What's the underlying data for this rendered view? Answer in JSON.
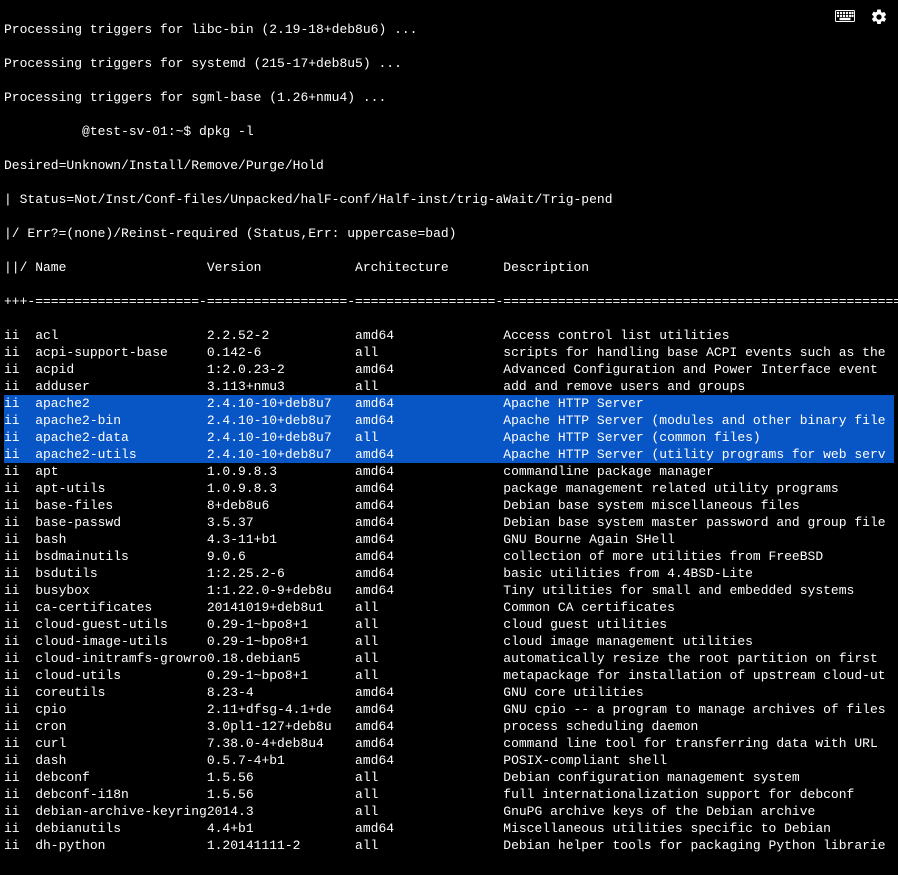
{
  "preamble": [
    "Processing triggers for libc-bin (2.19-18+deb8u6) ...",
    "Processing triggers for systemd (215-17+deb8u5) ...",
    "Processing triggers for sgml-base (1.26+nmu4) ..."
  ],
  "prompt": "          @test-sv-01:~$ dpkg -l",
  "header": [
    "Desired=Unknown/Install/Remove/Purge/Hold",
    "| Status=Not/Inst/Conf-files/Unpacked/halF-conf/Half-inst/trig-aWait/Trig-pend",
    "|/ Err?=(none)/Reinst-required (Status,Err: uppercase=bad)",
    "||/ Name                  Version            Architecture       Description",
    "+++-=====================-==================-==================-===================================================="
  ],
  "packages": [
    {
      "st": "ii",
      "name": "acl",
      "ver": "2.2.52-2",
      "arch": "amd64",
      "desc": "Access control list utilities",
      "hl": false
    },
    {
      "st": "ii",
      "name": "acpi-support-base",
      "ver": "0.142-6",
      "arch": "all",
      "desc": "scripts for handling base ACPI events such as the",
      "hl": false
    },
    {
      "st": "ii",
      "name": "acpid",
      "ver": "1:2.0.23-2",
      "arch": "amd64",
      "desc": "Advanced Configuration and Power Interface event",
      "hl": false
    },
    {
      "st": "ii",
      "name": "adduser",
      "ver": "3.113+nmu3",
      "arch": "all",
      "desc": "add and remove users and groups",
      "hl": false
    },
    {
      "st": "ii",
      "name": "apache2",
      "ver": "2.4.10-10+deb8u7",
      "arch": "amd64",
      "desc": "Apache HTTP Server",
      "hl": true
    },
    {
      "st": "ii",
      "name": "apache2-bin",
      "ver": "2.4.10-10+deb8u7",
      "arch": "amd64",
      "desc": "Apache HTTP Server (modules and other binary file",
      "hl": true
    },
    {
      "st": "ii",
      "name": "apache2-data",
      "ver": "2.4.10-10+deb8u7",
      "arch": "all",
      "desc": "Apache HTTP Server (common files)",
      "hl": true
    },
    {
      "st": "ii",
      "name": "apache2-utils",
      "ver": "2.4.10-10+deb8u7",
      "arch": "amd64",
      "desc": "Apache HTTP Server (utility programs for web serv",
      "hl": true
    },
    {
      "st": "ii",
      "name": "apt",
      "ver": "1.0.9.8.3",
      "arch": "amd64",
      "desc": "commandline package manager",
      "hl": false
    },
    {
      "st": "ii",
      "name": "apt-utils",
      "ver": "1.0.9.8.3",
      "arch": "amd64",
      "desc": "package management related utility programs",
      "hl": false
    },
    {
      "st": "ii",
      "name": "base-files",
      "ver": "8+deb8u6",
      "arch": "amd64",
      "desc": "Debian base system miscellaneous files",
      "hl": false
    },
    {
      "st": "ii",
      "name": "base-passwd",
      "ver": "3.5.37",
      "arch": "amd64",
      "desc": "Debian base system master password and group file",
      "hl": false
    },
    {
      "st": "ii",
      "name": "bash",
      "ver": "4.3-11+b1",
      "arch": "amd64",
      "desc": "GNU Bourne Again SHell",
      "hl": false
    },
    {
      "st": "ii",
      "name": "bsdmainutils",
      "ver": "9.0.6",
      "arch": "amd64",
      "desc": "collection of more utilities from FreeBSD",
      "hl": false
    },
    {
      "st": "ii",
      "name": "bsdutils",
      "ver": "1:2.25.2-6",
      "arch": "amd64",
      "desc": "basic utilities from 4.4BSD-Lite",
      "hl": false
    },
    {
      "st": "ii",
      "name": "busybox",
      "ver": "1:1.22.0-9+deb8u",
      "arch": "amd64",
      "desc": "Tiny utilities for small and embedded systems",
      "hl": false
    },
    {
      "st": "ii",
      "name": "ca-certificates",
      "ver": "20141019+deb8u1",
      "arch": "all",
      "desc": "Common CA certificates",
      "hl": false
    },
    {
      "st": "ii",
      "name": "cloud-guest-utils",
      "ver": "0.29-1~bpo8+1",
      "arch": "all",
      "desc": "cloud guest utilities",
      "hl": false
    },
    {
      "st": "ii",
      "name": "cloud-image-utils",
      "ver": "0.29-1~bpo8+1",
      "arch": "all",
      "desc": "cloud image management utilities",
      "hl": false
    },
    {
      "st": "ii",
      "name": "cloud-initramfs-growro",
      "ver": "0.18.debian5",
      "arch": "all",
      "desc": "automatically resize the root partition on first",
      "hl": false
    },
    {
      "st": "ii",
      "name": "cloud-utils",
      "ver": "0.29-1~bpo8+1",
      "arch": "all",
      "desc": "metapackage for installation of upstream cloud-ut",
      "hl": false
    },
    {
      "st": "ii",
      "name": "coreutils",
      "ver": "8.23-4",
      "arch": "amd64",
      "desc": "GNU core utilities",
      "hl": false
    },
    {
      "st": "ii",
      "name": "cpio",
      "ver": "2.11+dfsg-4.1+de",
      "arch": "amd64",
      "desc": "GNU cpio -- a program to manage archives of files",
      "hl": false
    },
    {
      "st": "ii",
      "name": "cron",
      "ver": "3.0pl1-127+deb8u",
      "arch": "amd64",
      "desc": "process scheduling daemon",
      "hl": false
    },
    {
      "st": "ii",
      "name": "curl",
      "ver": "7.38.0-4+deb8u4",
      "arch": "amd64",
      "desc": "command line tool for transferring data with URL",
      "hl": false
    },
    {
      "st": "ii",
      "name": "dash",
      "ver": "0.5.7-4+b1",
      "arch": "amd64",
      "desc": "POSIX-compliant shell",
      "hl": false
    },
    {
      "st": "ii",
      "name": "debconf",
      "ver": "1.5.56",
      "arch": "all",
      "desc": "Debian configuration management system",
      "hl": false
    },
    {
      "st": "ii",
      "name": "debconf-i18n",
      "ver": "1.5.56",
      "arch": "all",
      "desc": "full internationalization support for debconf",
      "hl": false
    },
    {
      "st": "ii",
      "name": "debian-archive-keyring",
      "ver": "2014.3",
      "arch": "all",
      "desc": "GnuPG archive keys of the Debian archive",
      "hl": false
    },
    {
      "st": "ii",
      "name": "debianutils",
      "ver": "4.4+b1",
      "arch": "amd64",
      "desc": "Miscellaneous utilities specific to Debian",
      "hl": false
    },
    {
      "st": "ii",
      "name": "dh-python",
      "ver": "1.20141111-2",
      "arch": "all",
      "desc": "Debian helper tools for packaging Python librarie",
      "hl": false
    }
  ]
}
